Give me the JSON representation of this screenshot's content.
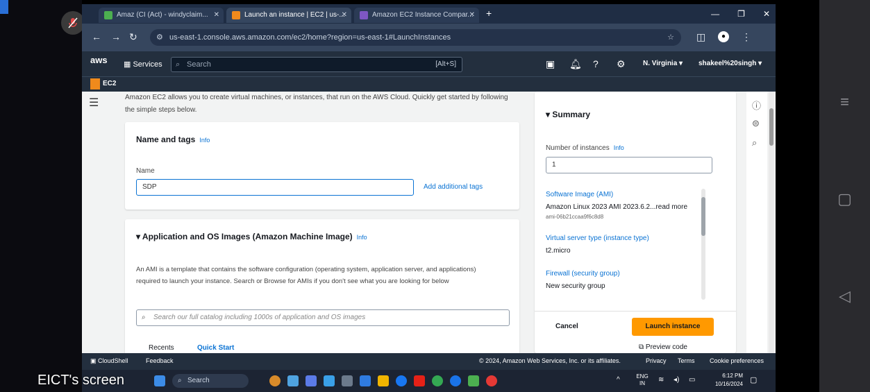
{
  "browser": {
    "tabs": [
      {
        "label": "Amaz (CI (Act) - windyclaim...",
        "color": "#4caf50"
      },
      {
        "label": "Launch an instance | EC2 | us-...",
        "color": "#f08a1c"
      },
      {
        "label": "Amazon EC2 Instance Compar...",
        "color": "#7e57c2"
      }
    ],
    "new_tab": "+",
    "url": "us-east-1.console.aws.amazon.com/ec2/home?region=us-east-1#LaunchInstances"
  },
  "aws": {
    "logo": "aws",
    "services_label": "Services",
    "search_placeholder": "Search",
    "search_shortcut": "[Alt+S]",
    "region": "N. Virginia ▾",
    "account": "shakeel%20singh ▾",
    "service_name": "EC2"
  },
  "intro": "Amazon EC2 allows you to create virtual machines, or instances, that run on the AWS Cloud. Quickly get started by following the simple steps below.",
  "name_tags": {
    "title": "Name and tags",
    "info": "Info",
    "name_label": "Name",
    "name_value": "SDP",
    "add_tags": "Add additional tags"
  },
  "ami": {
    "title": "Application and OS Images (Amazon Machine Image)",
    "info": "Info",
    "description": "An AMI is a template that contains the software configuration (operating system, application server, and applications) required to launch your instance. Search or Browse for AMIs if you don't see what you are looking for below",
    "search_placeholder": "Search our full catalog including 1000s of application and OS images",
    "tab_recents": "Recents",
    "tab_quickstart": "Quick Start"
  },
  "summary": {
    "title": "Summary",
    "num_instances_label": "Number of instances",
    "info": "Info",
    "num_instances_value": "1",
    "software_image_label": "Software Image (AMI)",
    "software_image_value": "Amazon Linux 2023 AMI 2023.6.2...read more",
    "ami_id": "ami-06b21ccaa9f6c8d8",
    "instance_type_label": "Virtual server type (instance type)",
    "instance_type_value": "t2.micro",
    "firewall_label": "Firewall (security group)",
    "firewall_value": "New security group",
    "cancel": "Cancel",
    "launch": "Launch instance",
    "preview": "Preview code"
  },
  "footer": {
    "cloudshell": "CloudShell",
    "feedback": "Feedback",
    "copyright": "© 2024, Amazon Web Services, Inc. or its affiliates.",
    "privacy": "Privacy",
    "terms": "Terms",
    "cookies": "Cookie preferences"
  },
  "overlay": {
    "screen_label": "EICT's screen"
  },
  "taskbar": {
    "search": "Search",
    "lang": "ENG IN",
    "time": "6:12 PM",
    "date": "10/16/2024"
  }
}
